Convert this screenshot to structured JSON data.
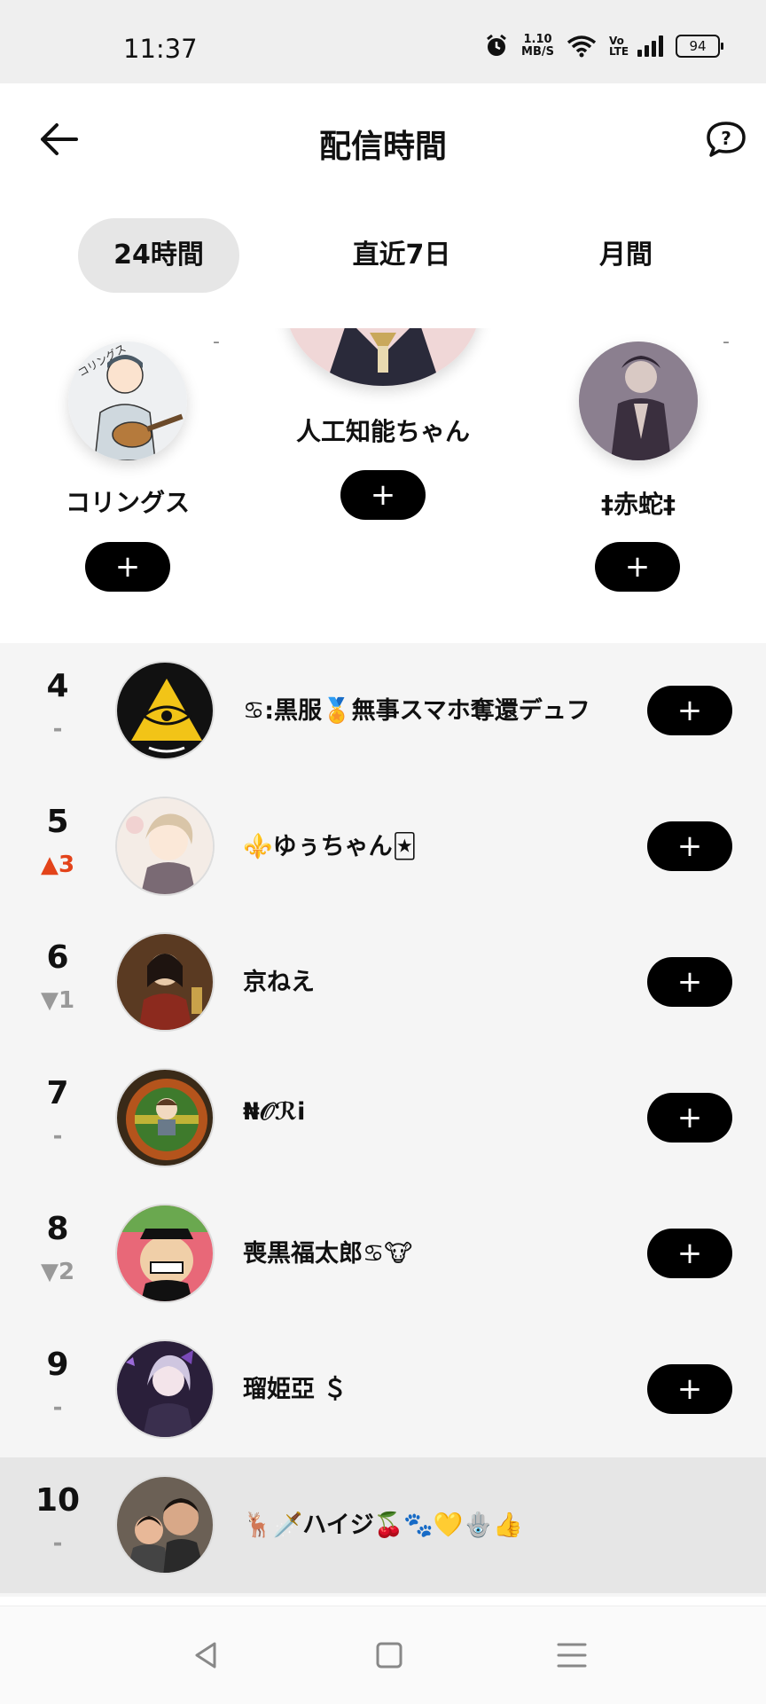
{
  "status": {
    "time": "11:37",
    "net_speed_value": "1.10",
    "net_speed_unit": "MB/S",
    "volte": "Vo LTE",
    "battery": "94"
  },
  "header": {
    "title": "配信時間"
  },
  "tabs": [
    {
      "label": "24時間",
      "active": true
    },
    {
      "label": "直近7日",
      "active": false
    },
    {
      "label": "月間",
      "active": false
    }
  ],
  "podium": {
    "first": {
      "name": "人工知能ちゃん",
      "plus": "+"
    },
    "second": {
      "name": "コリングス",
      "plus": "+",
      "change": "-"
    },
    "third": {
      "name": "‡赤蛇‡",
      "plus": "+",
      "change": "-"
    }
  },
  "ranking": [
    {
      "rank": "4",
      "change": "-",
      "name": "♋︎:黒服🏅無事スマホ奪還デュフ",
      "plus": "+"
    },
    {
      "rank": "5",
      "change": "▲3",
      "name": "⚜️ゆぅちゃん🃏",
      "plus": "+"
    },
    {
      "rank": "6",
      "change": "▼1",
      "name": "京ねえ",
      "plus": "+"
    },
    {
      "rank": "7",
      "change": "-",
      "name": "₦𝒪ℛi",
      "plus": "+"
    },
    {
      "rank": "8",
      "change": "▼2",
      "name": "喪黒福太郎♋︎🐮",
      "plus": "+"
    },
    {
      "rank": "9",
      "change": "-",
      "name": "瑠姫亞 ＄",
      "plus": "+"
    },
    {
      "rank": "10",
      "change": "-",
      "name": "🦌🗡️ハイジ🍒🐾💛🪬👍"
    }
  ],
  "colors": {
    "accent_black": "#000000",
    "rank_up": "#e3431a",
    "rank_down": "#999999",
    "tab_active_bg": "#e6e6e6",
    "list_bg": "#f5f5f5"
  },
  "icons": {
    "back": "arrow-left-icon",
    "help": "question-bubble-icon",
    "nav_back": "triangle-back-icon",
    "nav_home": "square-home-icon",
    "nav_menu": "menu-lines-icon"
  }
}
